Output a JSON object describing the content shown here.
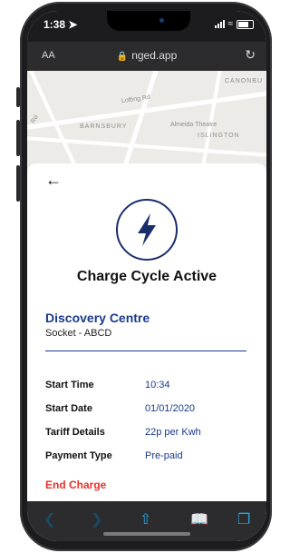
{
  "status": {
    "time": "1:38",
    "location_icon": "location-arrow-icon"
  },
  "browser": {
    "aa_label": "AA",
    "url": "nged.app",
    "lock_icon": "lock-icon",
    "reload_icon": "reload-icon"
  },
  "map": {
    "labels": [
      "CANONBU",
      "Lofting Rd",
      "BARNSBURY",
      "Almeida Theatre",
      "ISLINGTON",
      "Rd"
    ]
  },
  "charge": {
    "back_icon": "back-arrow-icon",
    "bolt_icon": "lightning-bolt-icon",
    "title": "Charge Cycle Active",
    "site_name": "Discovery Centre",
    "socket": "Socket - ABCD",
    "details": [
      {
        "label": "Start Time",
        "value": "10:34"
      },
      {
        "label": "Start Date",
        "value": "01/01/2020"
      },
      {
        "label": "Tariff Details",
        "value": "22p per Kwh"
      },
      {
        "label": "Payment Type",
        "value": "Pre-paid"
      }
    ],
    "end_label": "End Charge"
  },
  "toolbar": {
    "items": [
      "back-icon",
      "forward-icon",
      "share-icon",
      "bookmarks-icon",
      "tabs-icon"
    ]
  },
  "colors": {
    "accent": "#1a3a8c",
    "danger": "#e5322d",
    "toolbar_icon": "#2aa3df"
  }
}
